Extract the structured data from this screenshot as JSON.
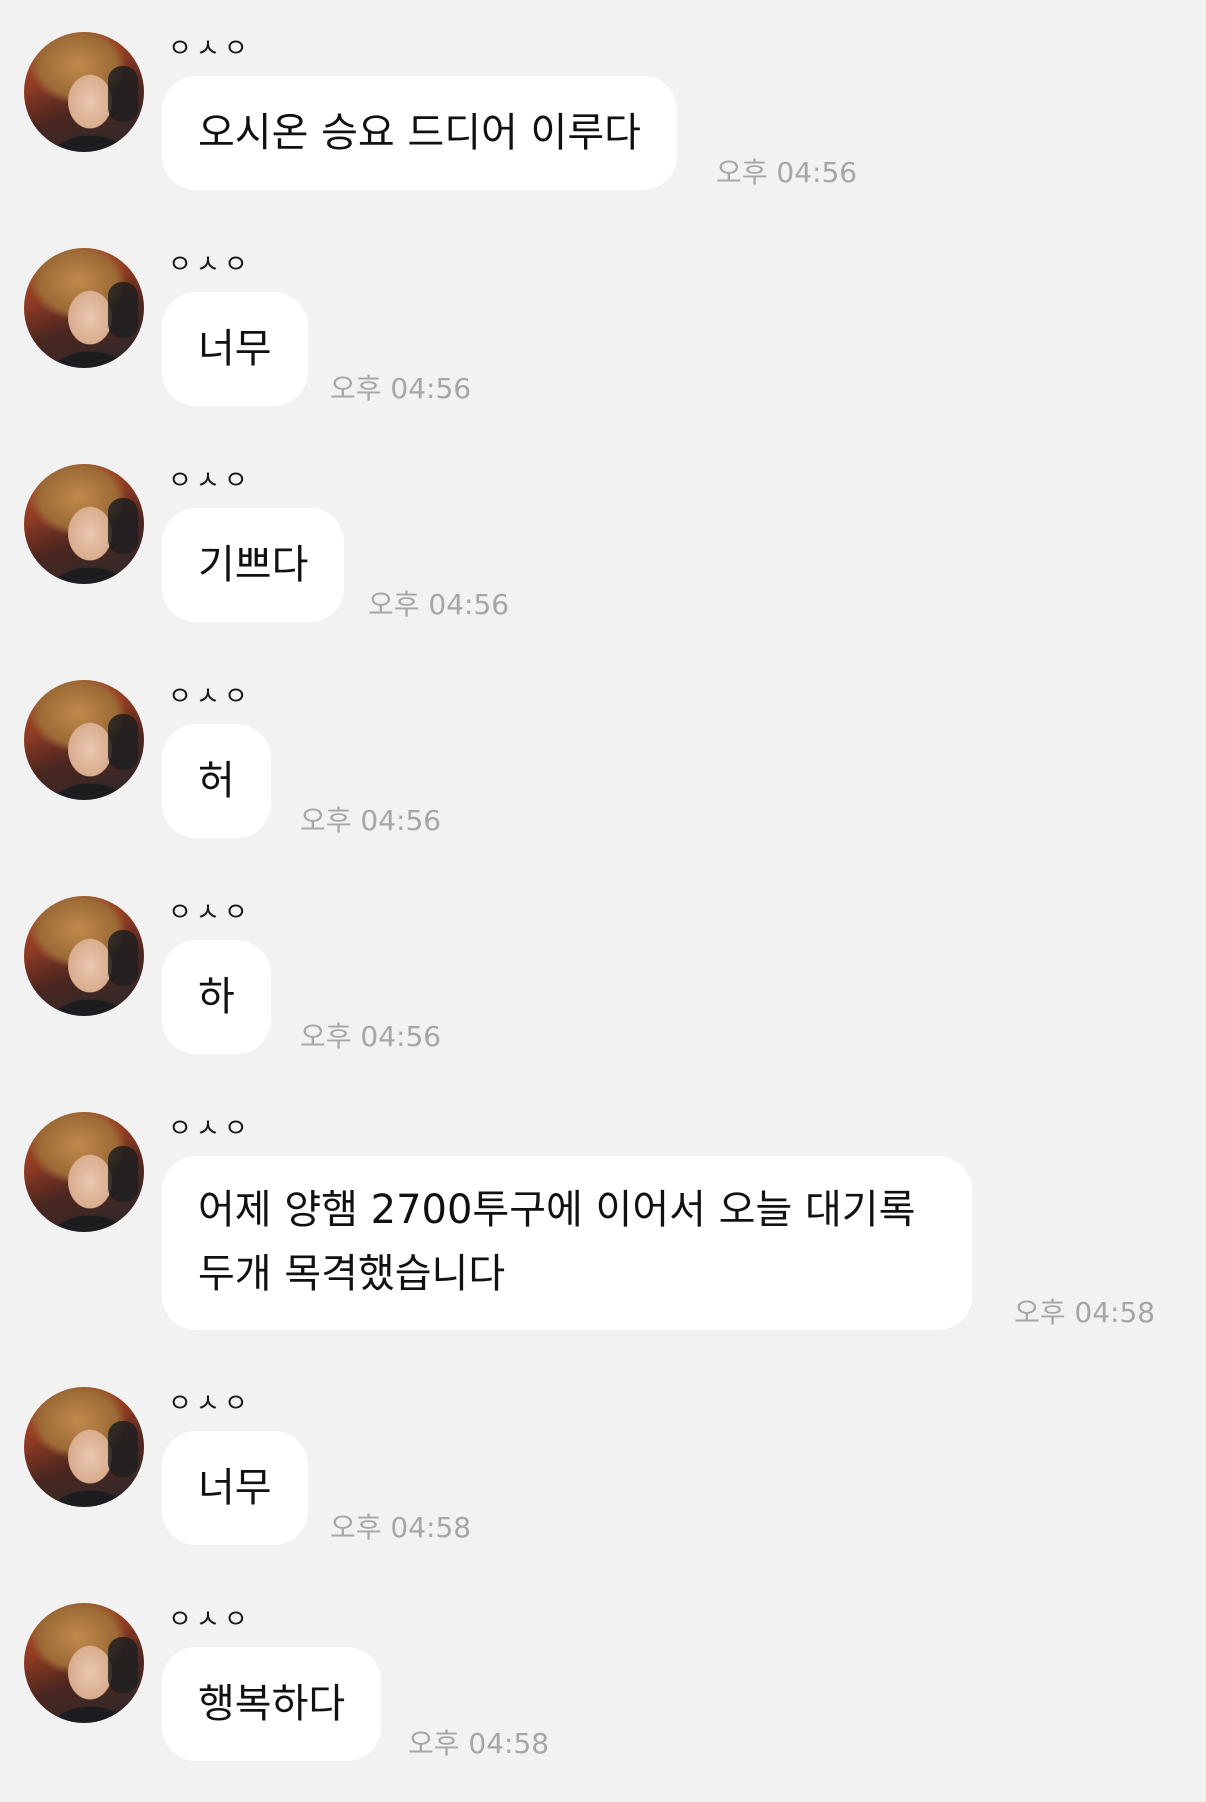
{
  "chat": {
    "messages": [
      {
        "sender": "ㅇㅅㅇ",
        "text": "오시온 승요 드디어 이루다",
        "time": "오후 04:56"
      },
      {
        "sender": "ㅇㅅㅇ",
        "text": "너무",
        "time": "오후 04:56"
      },
      {
        "sender": "ㅇㅅㅇ",
        "text": "기쁘다",
        "time": "오후 04:56"
      },
      {
        "sender": "ㅇㅅㅇ",
        "text": "허",
        "time": "오후 04:56"
      },
      {
        "sender": "ㅇㅅㅇ",
        "text": "하",
        "time": "오후 04:56"
      },
      {
        "sender": "ㅇㅅㅇ",
        "text_line1": "어제 양햄 2700투구에 이어서 오늘 대기록",
        "text_line2": "두개 목격했습니다",
        "time": "오후 04:58"
      },
      {
        "sender": "ㅇㅅㅇ",
        "text": "너무",
        "time": "오후 04:58"
      },
      {
        "sender": "ㅇㅅㅇ",
        "text": "행복하다",
        "time": "오후 04:58"
      }
    ]
  }
}
